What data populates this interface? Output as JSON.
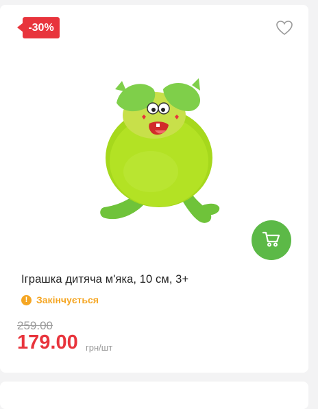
{
  "product": {
    "discount_badge": "-30%",
    "title": "Іграшка дитяча м'яка, 10 см, 3+",
    "stock_status": "Закінчується",
    "stock_icon": "!",
    "old_price": "259.00",
    "price": "179.00",
    "unit": "грн/шт",
    "image": "green-plush-toy",
    "icons": {
      "favorite": "heart-outline-icon",
      "cart": "cart-icon",
      "stock_warning": "exclamation-circle-icon"
    }
  },
  "colors": {
    "badge": "#e8343c",
    "price": "#e8343c",
    "cart_button": "#5cb947",
    "stock": "#f5a623"
  }
}
